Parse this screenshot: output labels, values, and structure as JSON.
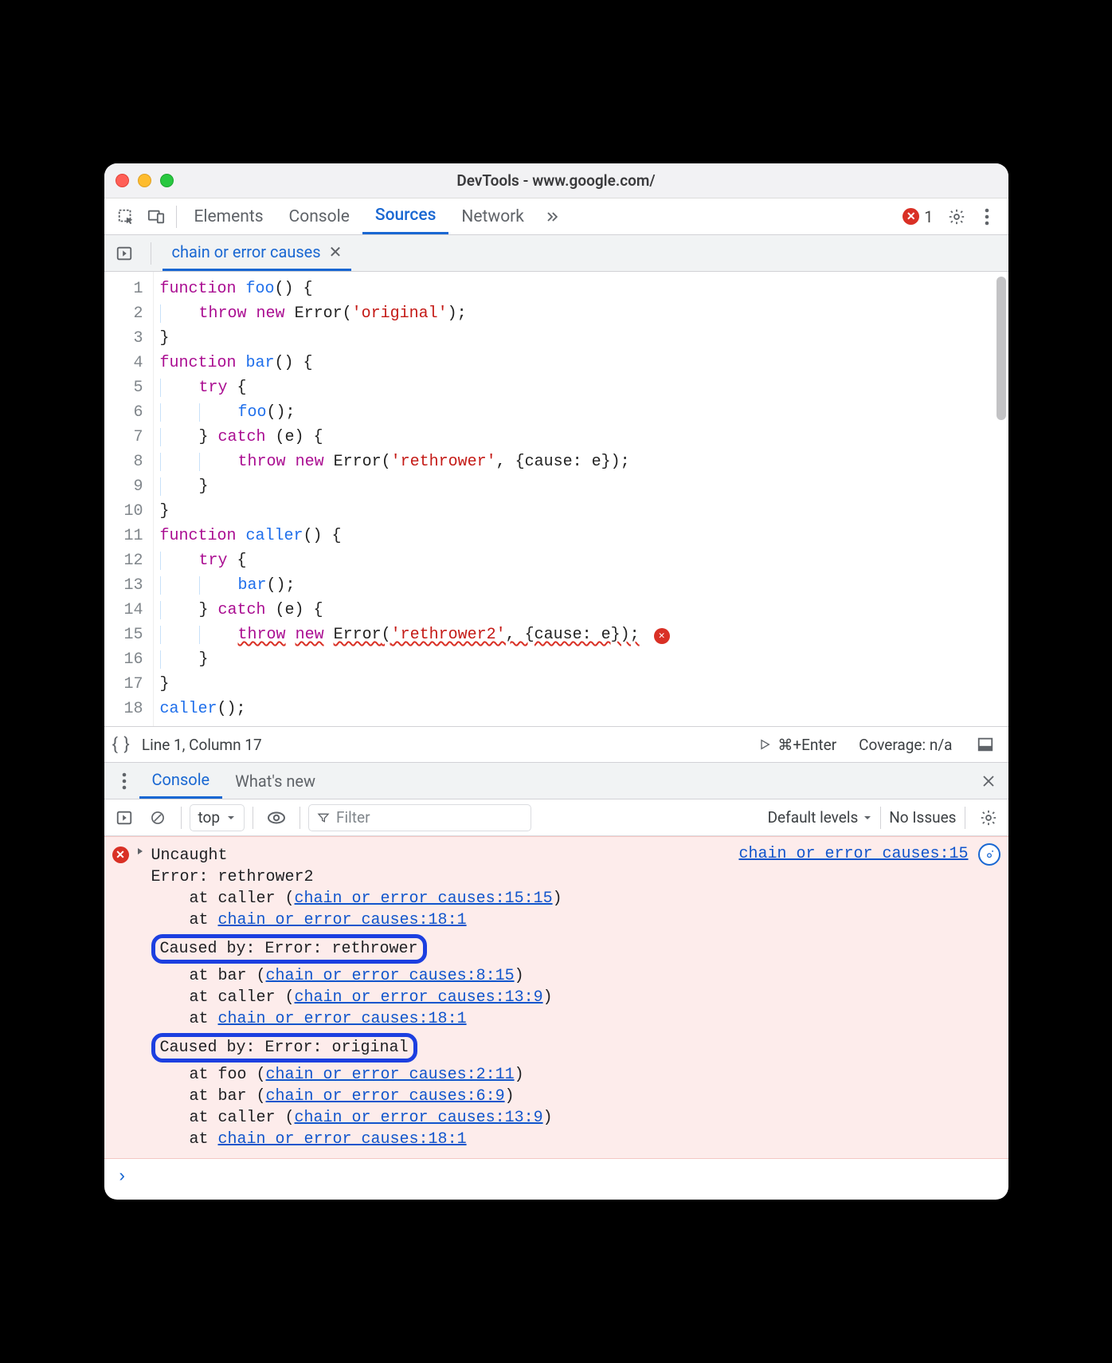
{
  "window": {
    "title": "DevTools - www.google.com/"
  },
  "panel_tabs": {
    "items": [
      "Elements",
      "Console",
      "Sources",
      "Network"
    ],
    "active": "Sources",
    "error_count": "1"
  },
  "file_tab": {
    "name": "chain or error causes"
  },
  "code": {
    "indent": "    ",
    "lines": [
      {
        "n": "1",
        "tokens": [
          [
            "kw",
            "function"
          ],
          [
            "pl",
            " "
          ],
          [
            "fn",
            "foo"
          ],
          [
            "pl",
            "() {"
          ]
        ]
      },
      {
        "n": "2",
        "tokens": [
          [
            "pl",
            "    "
          ],
          [
            "kw",
            "throw"
          ],
          [
            "pl",
            " "
          ],
          [
            "kw",
            "new"
          ],
          [
            "pl",
            " "
          ],
          [
            "type",
            "Error"
          ],
          [
            "pl",
            "("
          ],
          [
            "str",
            "'original'"
          ],
          [
            "pl",
            ");"
          ]
        ]
      },
      {
        "n": "3",
        "tokens": [
          [
            "pl",
            "}"
          ]
        ]
      },
      {
        "n": "4",
        "tokens": [
          [
            "kw",
            "function"
          ],
          [
            "pl",
            " "
          ],
          [
            "fn",
            "bar"
          ],
          [
            "pl",
            "() {"
          ]
        ]
      },
      {
        "n": "5",
        "tokens": [
          [
            "pl",
            "    "
          ],
          [
            "kw",
            "try"
          ],
          [
            "pl",
            " {"
          ]
        ]
      },
      {
        "n": "6",
        "tokens": [
          [
            "pl",
            "        "
          ],
          [
            "fn",
            "foo"
          ],
          [
            "pl",
            "();"
          ]
        ]
      },
      {
        "n": "7",
        "tokens": [
          [
            "pl",
            "    } "
          ],
          [
            "kw",
            "catch"
          ],
          [
            "pl",
            " (e) {"
          ]
        ]
      },
      {
        "n": "8",
        "tokens": [
          [
            "pl",
            "        "
          ],
          [
            "kw",
            "throw"
          ],
          [
            "pl",
            " "
          ],
          [
            "kw",
            "new"
          ],
          [
            "pl",
            " "
          ],
          [
            "type",
            "Error"
          ],
          [
            "pl",
            "("
          ],
          [
            "str",
            "'rethrower'"
          ],
          [
            "pl",
            ", {cause: e});"
          ]
        ]
      },
      {
        "n": "9",
        "tokens": [
          [
            "pl",
            "    }"
          ]
        ]
      },
      {
        "n": "10",
        "tokens": [
          [
            "pl",
            "}"
          ]
        ]
      },
      {
        "n": "11",
        "tokens": [
          [
            "kw",
            "function"
          ],
          [
            "pl",
            " "
          ],
          [
            "fn",
            "caller"
          ],
          [
            "pl",
            "() {"
          ]
        ]
      },
      {
        "n": "12",
        "tokens": [
          [
            "pl",
            "    "
          ],
          [
            "kw",
            "try"
          ],
          [
            "pl",
            " {"
          ]
        ]
      },
      {
        "n": "13",
        "tokens": [
          [
            "pl",
            "        "
          ],
          [
            "fn",
            "bar"
          ],
          [
            "pl",
            "();"
          ]
        ]
      },
      {
        "n": "14",
        "tokens": [
          [
            "pl",
            "    } "
          ],
          [
            "kw",
            "catch"
          ],
          [
            "pl",
            " (e) {"
          ]
        ]
      },
      {
        "n": "15",
        "tokens": [
          [
            "pl",
            "        "
          ],
          [
            "kw",
            "throw"
          ],
          [
            "pl",
            " "
          ],
          [
            "kw",
            "new"
          ],
          [
            "pl",
            " "
          ],
          [
            "type",
            "Error"
          ],
          [
            "pl",
            "("
          ],
          [
            "str",
            "'rethrower2'"
          ],
          [
            "pl",
            ", {cause: e});"
          ]
        ],
        "squiggle": true,
        "err_icon": true
      },
      {
        "n": "16",
        "tokens": [
          [
            "pl",
            "    }"
          ]
        ]
      },
      {
        "n": "17",
        "tokens": [
          [
            "pl",
            "}"
          ]
        ]
      },
      {
        "n": "18",
        "tokens": [
          [
            "fn",
            "caller"
          ],
          [
            "pl",
            "();"
          ]
        ]
      }
    ]
  },
  "editor_status": {
    "cursor": "Line 1, Column 17",
    "shortcut": "⌘+Enter",
    "coverage": "Coverage: n/a"
  },
  "drawer": {
    "tabs": [
      "Console",
      "What's new"
    ],
    "active": "Console"
  },
  "console_toolbar": {
    "context": "top",
    "filter_placeholder": "Filter",
    "levels": "Default levels",
    "issues": "No Issues"
  },
  "console_error": {
    "top_link": "chain or error causes:15",
    "uncaught": "Uncaught",
    "name": "Error: rethrower2",
    "stacks": [
      {
        "pre": "    at caller (",
        "link": "chain or error causes:15:15",
        "post": ")"
      },
      {
        "pre": "    at ",
        "link": "chain or error causes:18:1",
        "post": ""
      }
    ],
    "causes": [
      {
        "label": "Caused by: Error: rethrower",
        "stack": [
          {
            "pre": "    at bar (",
            "link": "chain or error causes:8:15",
            "post": ")"
          },
          {
            "pre": "    at caller (",
            "link": "chain or error causes:13:9",
            "post": ")"
          },
          {
            "pre": "    at ",
            "link": "chain or error causes:18:1",
            "post": ""
          }
        ]
      },
      {
        "label": "Caused by: Error: original",
        "stack": [
          {
            "pre": "    at foo (",
            "link": "chain or error causes:2:11",
            "post": ")"
          },
          {
            "pre": "    at bar (",
            "link": "chain or error causes:6:9",
            "post": ")"
          },
          {
            "pre": "    at caller (",
            "link": "chain or error causes:13:9",
            "post": ")"
          },
          {
            "pre": "    at ",
            "link": "chain or error causes:18:1",
            "post": ""
          }
        ]
      }
    ]
  },
  "prompt": "›"
}
